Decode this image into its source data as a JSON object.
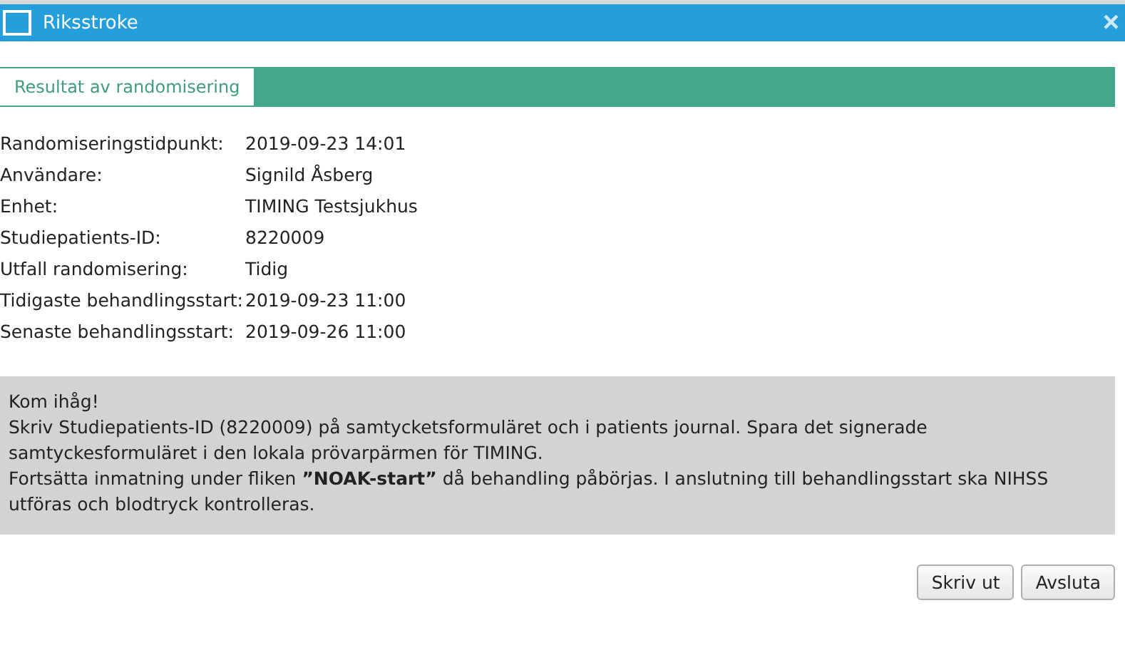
{
  "window": {
    "title": "Riksstroke",
    "close": "×"
  },
  "tabs": [
    {
      "label": "Resultat av randomisering",
      "selected": true
    }
  ],
  "fields": [
    {
      "label": "Randomiseringstidpunkt:",
      "value": "2019-09-23 14:01"
    },
    {
      "label": "Användare:",
      "value": "Signild Åsberg"
    },
    {
      "label": "Enhet:",
      "value": "TIMING Testsjukhus"
    },
    {
      "label": "Studiepatients-ID:",
      "value": "8220009"
    },
    {
      "label": "Utfall randomisering:",
      "value": "Tidig"
    },
    {
      "label": "Tidigaste behandlingsstart:",
      "value": "2019-09-23 11:00"
    },
    {
      "label": "Senaste behandlingsstart:",
      "value": "2019-09-26 11:00"
    }
  ],
  "notice": {
    "heading": "Kom ihåg!",
    "paragraphs": [
      "Skriv Studiepatients-ID (8220009) på samtycketsformuläret och i patients journal. Spara det signerade samtyckesformuläret i den lokala prövarpärmen för TIMING.",
      "Fortsätta inmatning under fliken **”NOAK-start”** då behandling påbörjas. I anslutning till behandlingsstart ska NIHSS utföras och blodtryck kontrolleras."
    ]
  },
  "buttons": [
    "Skriv ut",
    "Avsluta"
  ]
}
